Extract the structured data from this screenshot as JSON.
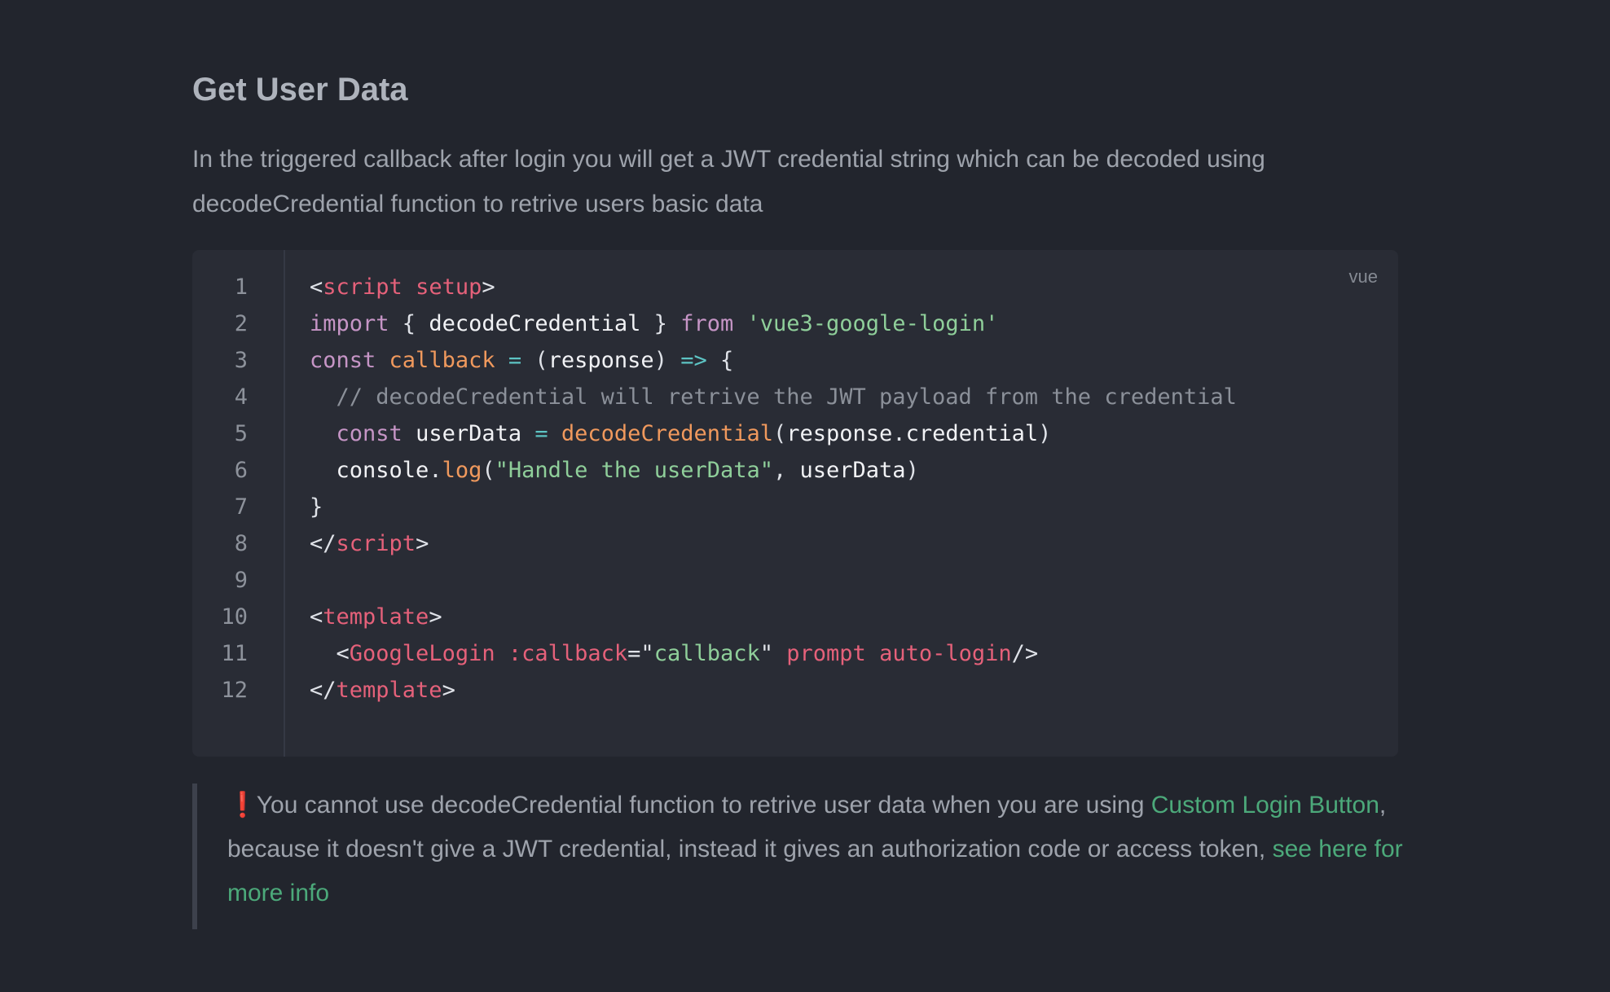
{
  "section": {
    "title": "Get User Data",
    "description": "In the triggered callback after login you will get a JWT credential string which can be decoded using decodeCredential function to retrive users basic data"
  },
  "code_block": {
    "language": "vue",
    "line_numbers": [
      "1",
      "2",
      "3",
      "4",
      "5",
      "6",
      "7",
      "8",
      "9",
      "10",
      "11",
      "12"
    ],
    "lines": [
      [
        {
          "t": "<",
          "c": "punc"
        },
        {
          "t": "script",
          "c": "tag"
        },
        {
          "t": " ",
          "c": "punc"
        },
        {
          "t": "setup",
          "c": "attr"
        },
        {
          "t": ">",
          "c": "punc"
        }
      ],
      [
        {
          "t": "import",
          "c": "kw"
        },
        {
          "t": " { ",
          "c": "punc"
        },
        {
          "t": "decodeCredential",
          "c": "id"
        },
        {
          "t": " } ",
          "c": "punc"
        },
        {
          "t": "from",
          "c": "kw"
        },
        {
          "t": " ",
          "c": "punc"
        },
        {
          "t": "'vue3-google-login'",
          "c": "str"
        }
      ],
      [
        {
          "t": "const",
          "c": "kw"
        },
        {
          "t": " ",
          "c": "punc"
        },
        {
          "t": "callback",
          "c": "fn"
        },
        {
          "t": " ",
          "c": "punc"
        },
        {
          "t": "=",
          "c": "op"
        },
        {
          "t": " (",
          "c": "punc"
        },
        {
          "t": "response",
          "c": "id"
        },
        {
          "t": ") ",
          "c": "punc"
        },
        {
          "t": "=>",
          "c": "op"
        },
        {
          "t": " {",
          "c": "punc"
        }
      ],
      [
        {
          "t": "  // decodeCredential will retrive the JWT payload from the credential",
          "c": "cmt"
        }
      ],
      [
        {
          "t": "  ",
          "c": "punc"
        },
        {
          "t": "const",
          "c": "kw"
        },
        {
          "t": " ",
          "c": "punc"
        },
        {
          "t": "userData",
          "c": "id"
        },
        {
          "t": " ",
          "c": "punc"
        },
        {
          "t": "=",
          "c": "op"
        },
        {
          "t": " ",
          "c": "punc"
        },
        {
          "t": "decodeCredential",
          "c": "fn"
        },
        {
          "t": "(",
          "c": "punc"
        },
        {
          "t": "response",
          "c": "id"
        },
        {
          "t": ".",
          "c": "punc"
        },
        {
          "t": "credential",
          "c": "id"
        },
        {
          "t": ")",
          "c": "punc"
        }
      ],
      [
        {
          "t": "  ",
          "c": "punc"
        },
        {
          "t": "console",
          "c": "id"
        },
        {
          "t": ".",
          "c": "punc"
        },
        {
          "t": "log",
          "c": "fn"
        },
        {
          "t": "(",
          "c": "punc"
        },
        {
          "t": "\"Handle the userData\"",
          "c": "str"
        },
        {
          "t": ", ",
          "c": "punc"
        },
        {
          "t": "userData",
          "c": "id"
        },
        {
          "t": ")",
          "c": "punc"
        }
      ],
      [
        {
          "t": "}",
          "c": "punc"
        }
      ],
      [
        {
          "t": "</",
          "c": "punc"
        },
        {
          "t": "script",
          "c": "tag"
        },
        {
          "t": ">",
          "c": "punc"
        }
      ],
      [],
      [
        {
          "t": "<",
          "c": "punc"
        },
        {
          "t": "template",
          "c": "tag"
        },
        {
          "t": ">",
          "c": "punc"
        }
      ],
      [
        {
          "t": "  <",
          "c": "punc"
        },
        {
          "t": "GoogleLogin",
          "c": "tag"
        },
        {
          "t": " ",
          "c": "punc"
        },
        {
          "t": ":callback",
          "c": "attr"
        },
        {
          "t": "=\"",
          "c": "punc"
        },
        {
          "t": "callback",
          "c": "str"
        },
        {
          "t": "\" ",
          "c": "punc"
        },
        {
          "t": "prompt",
          "c": "attr"
        },
        {
          "t": " ",
          "c": "punc"
        },
        {
          "t": "auto-login",
          "c": "attr"
        },
        {
          "t": "/>",
          "c": "punc"
        }
      ],
      [
        {
          "t": "</",
          "c": "punc"
        },
        {
          "t": "template",
          "c": "tag"
        },
        {
          "t": ">",
          "c": "punc"
        }
      ]
    ]
  },
  "callout": {
    "icon": "❗",
    "text_before": " You cannot use decodeCredential function to retrive user data when you are using ",
    "link1_label": "Custom Login Button",
    "text_middle": ", because it doesn't give a JWT credential, instead it gives an authorization code or access token, ",
    "link2_label": "see here for more info"
  },
  "colors": {
    "background": "#22252d",
    "code_background": "#292c35",
    "link": "#4ca97a",
    "warning_icon": "#e02b32"
  }
}
